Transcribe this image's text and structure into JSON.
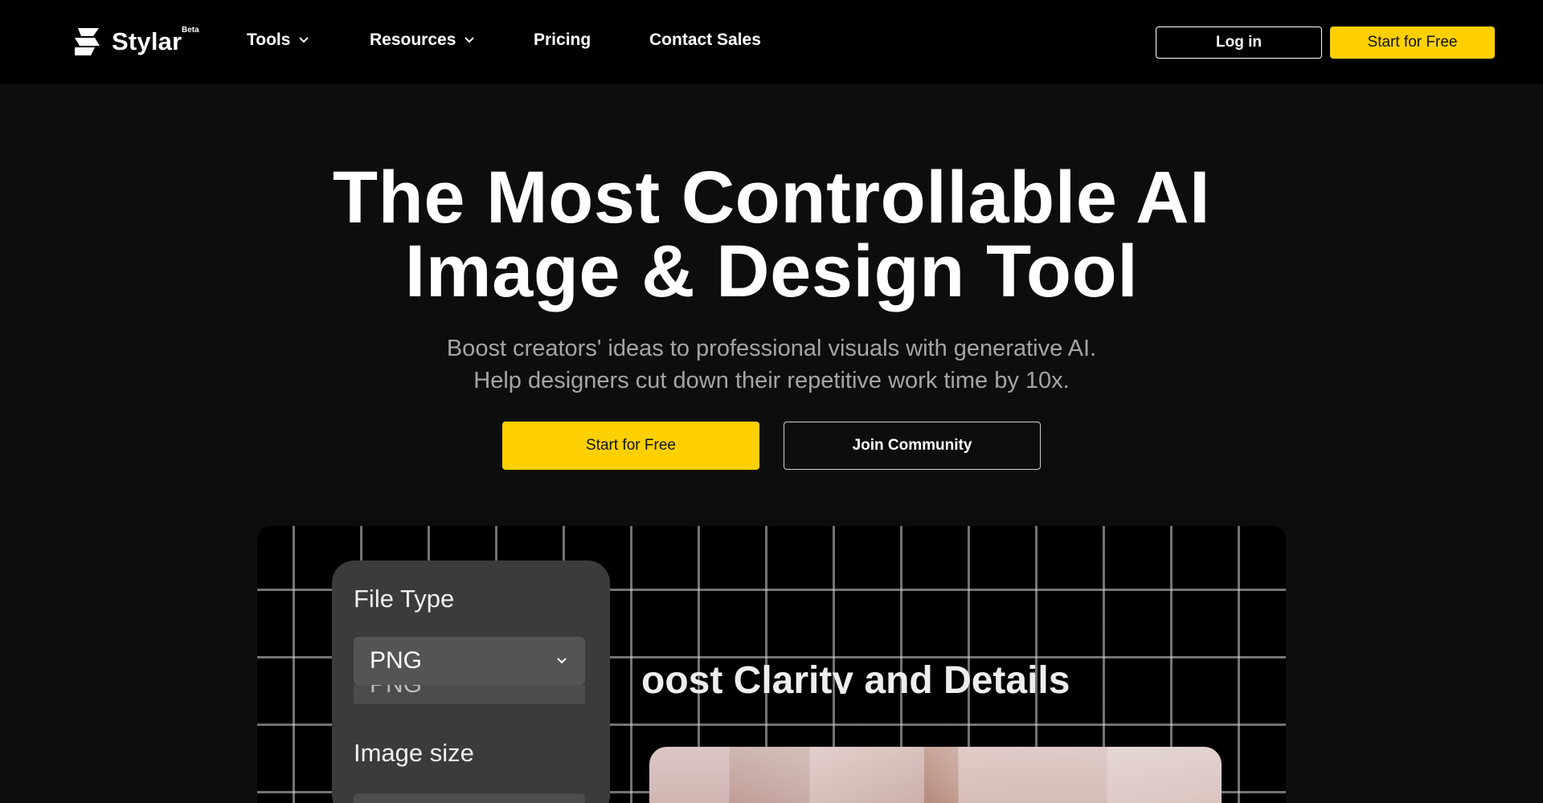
{
  "brand": {
    "name": "Stylar",
    "badge": "Beta",
    "accent_color": "#ffd000"
  },
  "nav": {
    "items": [
      {
        "label": "Tools",
        "has_dropdown": true,
        "icon": "chevron-down-icon"
      },
      {
        "label": "Resources",
        "has_dropdown": true,
        "icon": "chevron-down-icon"
      },
      {
        "label": "Pricing",
        "has_dropdown": false
      },
      {
        "label": "Contact Sales",
        "has_dropdown": false
      }
    ],
    "login_label": "Log in",
    "start_label": "Start for Free"
  },
  "hero": {
    "title_line1": "The Most Controllable AI",
    "title_line2": "Image & Design Tool",
    "subtitle_line1": "Boost creators' ideas to professional visuals with generative AI.",
    "subtitle_line2": "Help designers cut down their repetitive work time by 10x.",
    "primary_cta": "Start for Free",
    "secondary_cta": "Join Community"
  },
  "demo": {
    "file_type_label": "File Type",
    "file_type_value": "PNG",
    "file_type_ghost": "PNG",
    "image_size_label": "Image size",
    "heading": "oost Clarity and Details"
  }
}
